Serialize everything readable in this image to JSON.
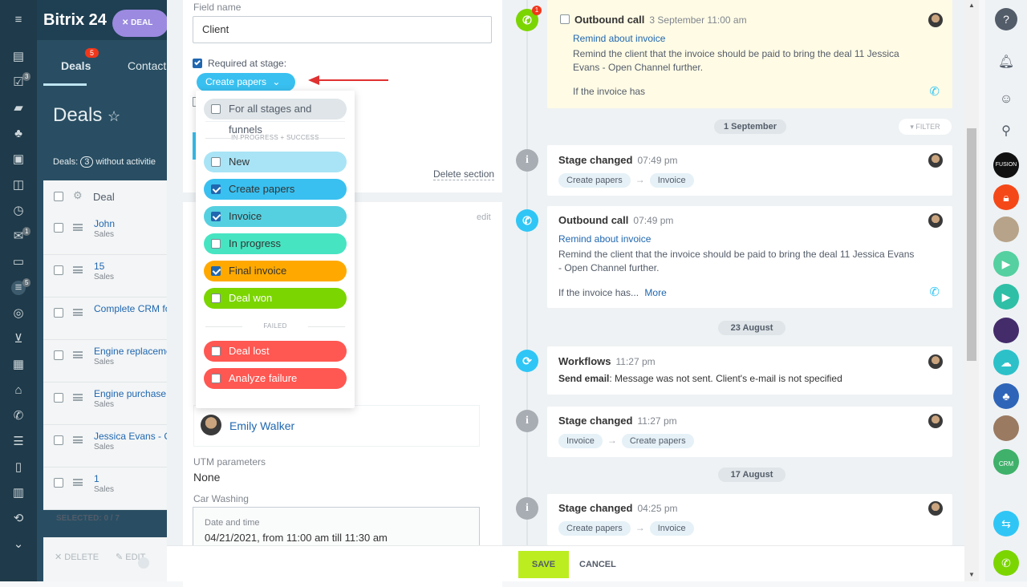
{
  "app": {
    "name": "Bitrix 24",
    "deal_badge": "DEAL"
  },
  "bg": {
    "tab_deals": "Deals",
    "tab_deals_count": "5",
    "tab_contacts": "Contact",
    "title": "Deals",
    "filter_text": "Deals:",
    "filter_count": "3",
    "filter_rest": "without activitie",
    "col_deal": "Deal",
    "rows": [
      {
        "title": "John",
        "sub": "Sales"
      },
      {
        "title": "15",
        "sub": "Sales"
      },
      {
        "title": "Complete CRM fo \"Feedback\"",
        "sub": ""
      },
      {
        "title": "Engine replaceme",
        "sub": "Sales"
      },
      {
        "title": "Engine purchase",
        "sub": "Sales"
      },
      {
        "title": "Jessica Evans - C",
        "sub": "Sales"
      },
      {
        "title": "1",
        "sub": "Sales"
      }
    ],
    "selected": "SELECTED: 0 / 7",
    "delete": "DELETE",
    "edit": "EDIT"
  },
  "form": {
    "field_name_label": "Field name",
    "field_name_value": "Client",
    "required_label": "Required at stage:",
    "stage_button": "Create papers",
    "delete_section": "Delete section",
    "edit": "edit",
    "responsible_name": "Emily Walker",
    "utm_label": "UTM parameters",
    "utm_value": "None",
    "car_label": "Car Washing",
    "date_label": "Date and time",
    "date_value": "04/21/2021, from 11:00 am till 11:30 am"
  },
  "dropdown": {
    "all_stages": "For all stages and funnels",
    "section_progress": "IN PROGRESS + SUCCESS",
    "section_failed": "FAILED",
    "options": [
      {
        "label": "New",
        "checked": false,
        "color": "#a8e4f6",
        "dark": true
      },
      {
        "label": "Create papers",
        "checked": true,
        "color": "#39c0f0",
        "dark": true
      },
      {
        "label": "Invoice",
        "checked": true,
        "color": "#55d0e0",
        "dark": true
      },
      {
        "label": "In progress",
        "checked": false,
        "color": "#47e4c2",
        "dark": true
      },
      {
        "label": "Final invoice",
        "checked": true,
        "color": "#ffa900",
        "dark": true
      },
      {
        "label": "Deal won",
        "checked": false,
        "color": "#7bd500",
        "dark": false
      },
      {
        "label": "Deal lost",
        "checked": false,
        "color": "#ff5752",
        "dark": false
      },
      {
        "label": "Analyze failure",
        "checked": false,
        "color": "#ff5752",
        "dark": false
      }
    ]
  },
  "timeline": {
    "call1": {
      "title": "Outbound call",
      "time": "3 September 11:00 am",
      "badge": "1",
      "subject": "Remind about invoice",
      "body": "Remind the client that the invoice should be paid to bring the deal 11 Jessica Evans - Open Channel further.",
      "note": "If the invoice has"
    },
    "date1": "1 September",
    "filter": "FILTER",
    "stage1": {
      "title": "Stage changed",
      "time": "07:49 pm",
      "from": "Create papers",
      "to": "Invoice"
    },
    "call2": {
      "title": "Outbound call",
      "time": "07:49 pm",
      "subject": "Remind about invoice",
      "body": "Remind the client that the invoice should be paid to bring the deal 11 Jessica Evans - Open Channel further.",
      "note": "If the invoice has...",
      "more": "More"
    },
    "date2": "23 August",
    "wf": {
      "title": "Workflows",
      "time": "11:27 pm",
      "label": "Send email",
      "text": ": Message was not sent. Client's e-mail is not specified"
    },
    "stage2": {
      "title": "Stage changed",
      "time": "11:27 pm",
      "from": "Invoice",
      "to": "Create papers"
    },
    "date3": "17 August",
    "stage3": {
      "title": "Stage changed",
      "time": "04:25 pm",
      "from": "Create papers",
      "to": "Invoice"
    }
  },
  "footer": {
    "save": "SAVE",
    "cancel": "CANCEL"
  },
  "rightbar": {
    "crm_label": "CRM"
  }
}
